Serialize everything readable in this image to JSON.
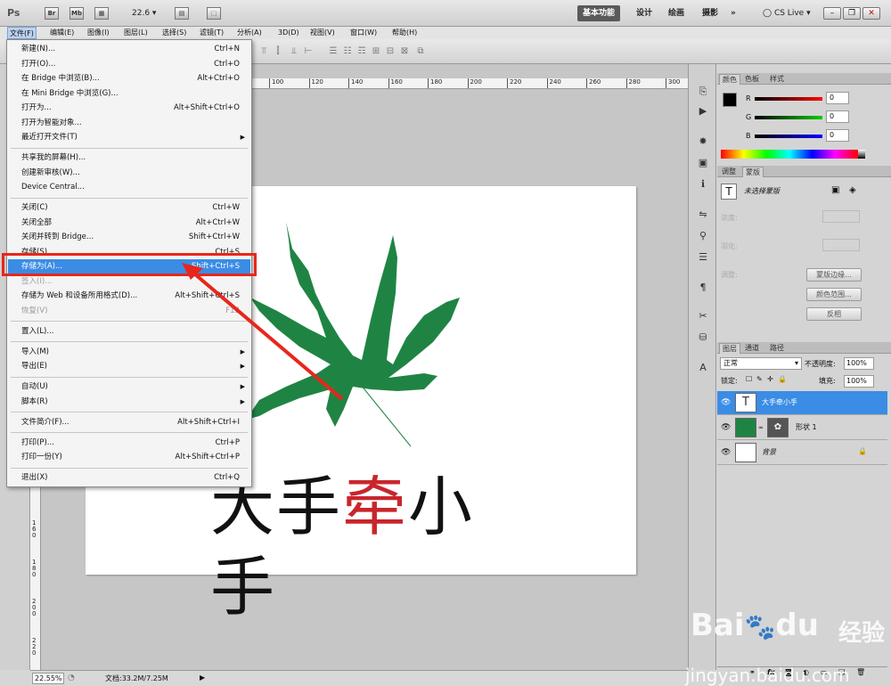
{
  "titlebar": {
    "logo": "Ps",
    "icon_br": "Br",
    "icon_mb": "Mb",
    "zoom": "22.6",
    "workspaces": [
      "基本功能",
      "设计",
      "绘画",
      "摄影"
    ],
    "more": "»",
    "cslive": "CS Live"
  },
  "menubar": {
    "items": [
      "文件(F)",
      "编辑(E)",
      "图像(I)",
      "图层(L)",
      "选择(S)",
      "滤镜(T)",
      "分析(A)",
      "3D(D)",
      "视图(V)",
      "窗口(W)",
      "帮助(H)"
    ]
  },
  "file_menu": {
    "groups": [
      [
        {
          "label": "新建(N)...",
          "shortcut": "Ctrl+N"
        },
        {
          "label": "打开(O)...",
          "shortcut": "Ctrl+O"
        },
        {
          "label": "在 Bridge 中浏览(B)...",
          "shortcut": "Alt+Ctrl+O"
        },
        {
          "label": "在 Mini Bridge 中浏览(G)...",
          "shortcut": ""
        },
        {
          "label": "打开为...",
          "shortcut": "Alt+Shift+Ctrl+O"
        },
        {
          "label": "打开为智能对象...",
          "shortcut": ""
        },
        {
          "label": "最近打开文件(T)",
          "shortcut": "",
          "submenu": true
        }
      ],
      [
        {
          "label": "共享我的屏幕(H)...",
          "shortcut": ""
        },
        {
          "label": "创建新审核(W)...",
          "shortcut": ""
        },
        {
          "label": "Device Central...",
          "shortcut": ""
        }
      ],
      [
        {
          "label": "关闭(C)",
          "shortcut": "Ctrl+W"
        },
        {
          "label": "关闭全部",
          "shortcut": "Alt+Ctrl+W"
        },
        {
          "label": "关闭并转到 Bridge...",
          "shortcut": "Shift+Ctrl+W"
        },
        {
          "label": "存储(S)",
          "shortcut": "Ctrl+S"
        },
        {
          "label": "存储为(A)...",
          "shortcut": "Shift+Ctrl+S",
          "selected": true
        },
        {
          "label": "签入(I)...",
          "shortcut": "",
          "disabled": true
        },
        {
          "label": "存储为 Web 和设备所用格式(D)...",
          "shortcut": "Alt+Shift+Ctrl+S"
        },
        {
          "label": "恢复(V)",
          "shortcut": "F12",
          "disabled": true
        }
      ],
      [
        {
          "label": "置入(L)...",
          "shortcut": ""
        }
      ],
      [
        {
          "label": "导入(M)",
          "shortcut": "",
          "submenu": true
        },
        {
          "label": "导出(E)",
          "shortcut": "",
          "submenu": true
        }
      ],
      [
        {
          "label": "自动(U)",
          "shortcut": "",
          "submenu": true
        },
        {
          "label": "脚本(R)",
          "shortcut": "",
          "submenu": true
        }
      ],
      [
        {
          "label": "文件简介(F)...",
          "shortcut": "Alt+Shift+Ctrl+I"
        }
      ],
      [
        {
          "label": "打印(P)...",
          "shortcut": "Ctrl+P"
        },
        {
          "label": "打印一份(Y)",
          "shortcut": "Alt+Shift+Ctrl+P"
        }
      ],
      [
        {
          "label": "退出(X)",
          "shortcut": "Ctrl+Q"
        }
      ]
    ]
  },
  "ruler_top": [
    "100",
    "120",
    "140",
    "160",
    "180",
    "200",
    "220",
    "240",
    "260",
    "280",
    "300",
    "320"
  ],
  "ruler_left": [
    "1\n6\n0",
    "1\n8\n0",
    "2\n0\n0",
    "2\n2\n0",
    "2\n4\n0"
  ],
  "canvas": {
    "text_parts": [
      "大手",
      "牵",
      "小手"
    ],
    "leaf_color": "#1f8443",
    "accent_red": "#c8262c"
  },
  "statusbar": {
    "zoom": "22.55%",
    "doc": "文档:33.2M/7.25M"
  },
  "color_panel": {
    "tabs": [
      "颜色",
      "色板",
      "样式"
    ],
    "channels": [
      {
        "name": "R",
        "value": "0"
      },
      {
        "name": "G",
        "value": "0"
      },
      {
        "name": "B",
        "value": "0"
      }
    ]
  },
  "adjust_panel": {
    "tabs": [
      "调整",
      "蒙版"
    ],
    "title": "未选择蒙版",
    "density": "浓度:",
    "feather": "羽化:",
    "refine": "调整:",
    "btn_edge": "蒙版边缘...",
    "btn_range": "颜色范围...",
    "btn_invert": "反相"
  },
  "layers_panel": {
    "tabs": [
      "图层",
      "通道",
      "路径"
    ],
    "blend_mode": "正常",
    "opacity_label": "不透明度:",
    "opacity": "100%",
    "lock_label": "锁定:",
    "fill_label": "填充:",
    "fill": "100%",
    "layers": [
      {
        "name": "大手牵小手",
        "type": "text",
        "selected": true
      },
      {
        "name": "形状 1",
        "type": "shape"
      },
      {
        "name": "背景",
        "type": "background"
      }
    ]
  },
  "watermark": {
    "brand": "Bai",
    "brand2": "du",
    "jingyan": "经验",
    "url": "jingyan.baidu.com"
  }
}
